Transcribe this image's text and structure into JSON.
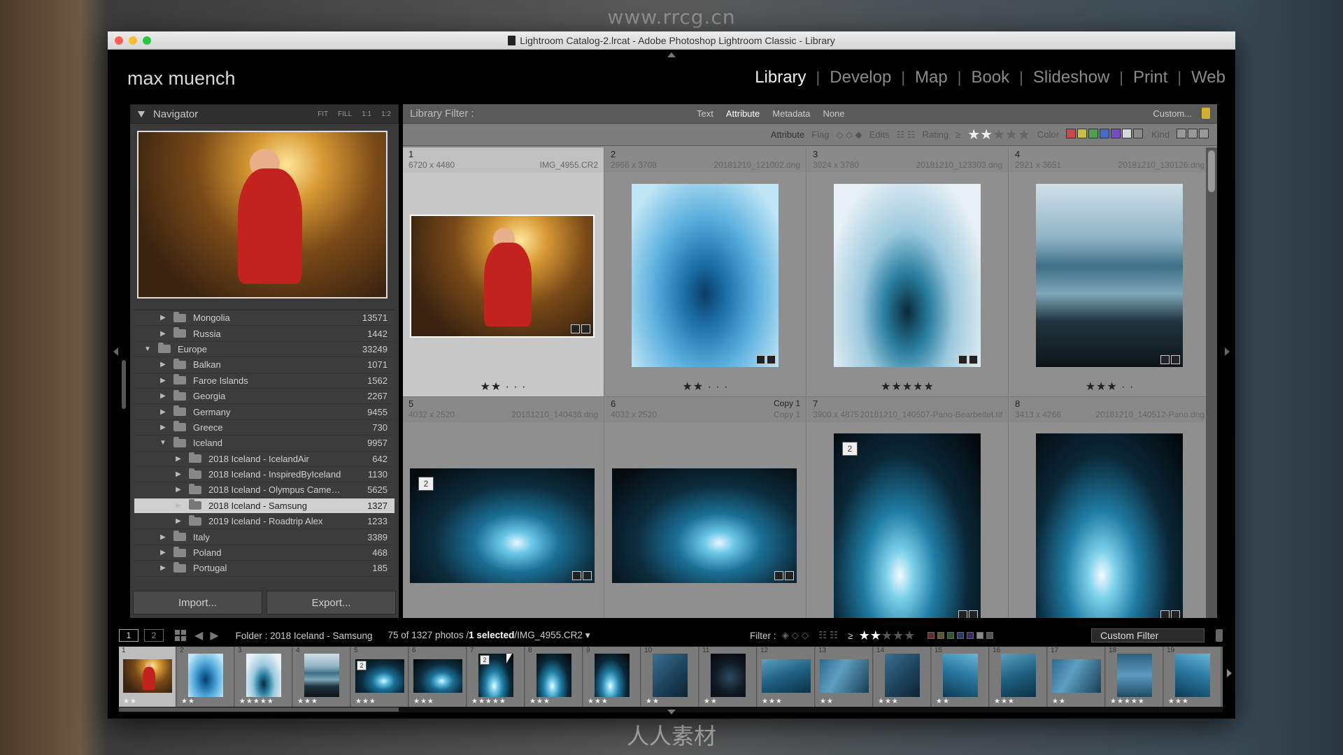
{
  "watermarks": {
    "top": "www.rrcg.cn",
    "bottom": "人人素材"
  },
  "window": {
    "title": "Lightroom Catalog-2.lrcat - Adobe Photoshop Lightroom Classic - Library"
  },
  "identity_plate": "max muench",
  "modules": [
    {
      "label": "Library",
      "active": true
    },
    {
      "label": "Develop"
    },
    {
      "label": "Map"
    },
    {
      "label": "Book"
    },
    {
      "label": "Slideshow"
    },
    {
      "label": "Print"
    },
    {
      "label": "Web"
    }
  ],
  "navigator": {
    "title": "Navigator",
    "zoom_options": [
      "FIT",
      "FILL",
      "1:1",
      "1:2"
    ]
  },
  "folders": [
    {
      "label": "Mongolia",
      "count": "13571",
      "level": 1,
      "expanded": false
    },
    {
      "label": "Russia",
      "count": "1442",
      "level": 1,
      "expanded": false
    },
    {
      "label": "Europe",
      "count": "33249",
      "level": 0,
      "expanded": true
    },
    {
      "label": "Balkan",
      "count": "1071",
      "level": 1,
      "expanded": false
    },
    {
      "label": "Faroe Islands",
      "count": "1562",
      "level": 1,
      "expanded": false
    },
    {
      "label": "Georgia",
      "count": "2267",
      "level": 1,
      "expanded": false
    },
    {
      "label": "Germany",
      "count": "9455",
      "level": 1,
      "expanded": false
    },
    {
      "label": "Greece",
      "count": "730",
      "level": 1,
      "expanded": false
    },
    {
      "label": "Iceland",
      "count": "9957",
      "level": 1,
      "expanded": true
    },
    {
      "label": "2018 Iceland - IcelandAir",
      "count": "642",
      "level": 2,
      "expanded": false
    },
    {
      "label": "2018 Iceland - InspiredByIceland",
      "count": "1130",
      "level": 2,
      "expanded": false
    },
    {
      "label": "2018 Iceland - Olympus Came…",
      "count": "5625",
      "level": 2,
      "expanded": false
    },
    {
      "label": "2018 Iceland - Samsung",
      "count": "1327",
      "level": 2,
      "expanded": false,
      "selected": true
    },
    {
      "label": "2019 Iceland - Roadtrip Alex",
      "count": "1233",
      "level": 2,
      "expanded": false
    },
    {
      "label": "Italy",
      "count": "3389",
      "level": 1,
      "expanded": false
    },
    {
      "label": "Poland",
      "count": "468",
      "level": 1,
      "expanded": false
    },
    {
      "label": "Portugal",
      "count": "185",
      "level": 1,
      "expanded": false
    }
  ],
  "buttons": {
    "import": "Import...",
    "export": "Export..."
  },
  "library_filter": {
    "title": "Library Filter :",
    "tabs": [
      {
        "label": "Text"
      },
      {
        "label": "Attribute",
        "active": true
      },
      {
        "label": "Metadata"
      },
      {
        "label": "None"
      }
    ],
    "preset": "Custom...",
    "attribute_bar": {
      "attribute_label": "Attribute",
      "flag_label": "Flag",
      "edits_label": "Edits",
      "rating_label": "Rating",
      "rating_op": "≥",
      "rating_value": 2,
      "color_label": "Color",
      "colors": [
        "#c84a4a",
        "#c8c040",
        "#50a050",
        "#4a6ac8",
        "#7a4ac0",
        "#d8d8d8",
        "#8a8a8a"
      ],
      "kind_label": "Kind"
    }
  },
  "grid": [
    {
      "index": "1",
      "dims": "6720 x 4480",
      "file": "IMG_4955.CR2",
      "rating": 2,
      "selected": true,
      "art": "art-room",
      "orient": "land"
    },
    {
      "index": "2",
      "dims": "2966 x 3708",
      "file": "20181210_121002.dng",
      "rating": 2,
      "art": "art-ice1",
      "orient": "port"
    },
    {
      "index": "3",
      "dims": "3024 x 3780",
      "file": "20181210_123303.dng",
      "rating": 5,
      "art": "art-ice2",
      "orient": "port"
    },
    {
      "index": "4",
      "dims": "2921 x 3651",
      "file": "20181210_130126.dng",
      "rating": 3,
      "art": "art-lake",
      "orient": "port"
    },
    {
      "index": "5",
      "dims": "4032 x 2520",
      "file": "20181210_140438.dng",
      "stack": "2",
      "art": "art-cave",
      "orient": "land"
    },
    {
      "index": "6",
      "dims": "4032 x 2520",
      "file": "Copy 1",
      "copy": "Copy 1",
      "art": "art-cave",
      "orient": "land"
    },
    {
      "index": "7",
      "dims": "3900 x 4875",
      "file": "20181210_140507-Pano-Bearbeitet.tif",
      "stack": "2",
      "art": "art-cave-v",
      "orient": "port"
    },
    {
      "index": "8",
      "dims": "3413 x 4266",
      "file": "20181210_140512-Pano.dng",
      "art": "art-cave-v",
      "orient": "port"
    }
  ],
  "filmbar": {
    "screen1": "1",
    "screen2": "2",
    "path": "Folder : 2018 Iceland - Samsung",
    "count_prefix": "75 of 1327 photos /",
    "count_selected": "1 selected",
    "count_file": "/IMG_4955.CR2",
    "filter_label": "Filter :",
    "rating_op": "≥",
    "rating_value": 2,
    "filter_preset": "Custom Filter"
  },
  "filmstrip": [
    {
      "n": "1",
      "stars": "★★",
      "art": "art-room",
      "selected": true
    },
    {
      "n": "2",
      "stars": "★★",
      "art": "art-ice1"
    },
    {
      "n": "3",
      "stars": "★★★★★",
      "art": "art-ice2"
    },
    {
      "n": "4",
      "stars": "★★★",
      "art": "art-lake"
    },
    {
      "n": "5",
      "stars": "★★★",
      "art": "art-cave",
      "stack": "2"
    },
    {
      "n": "6",
      "stars": "★★★",
      "art": "art-cave"
    },
    {
      "n": "7",
      "stars": "★★★★★",
      "art": "art-cave-v",
      "stack": "2"
    },
    {
      "n": "8",
      "stars": "★★★",
      "art": "art-cave-v"
    },
    {
      "n": "9",
      "stars": "★★★",
      "art": "art-cave-v"
    },
    {
      "n": "10",
      "stars": "★★",
      "art": "art-blue1"
    },
    {
      "n": "11",
      "stars": "★★",
      "art": "art-dark"
    },
    {
      "n": "12",
      "stars": "★★★",
      "art": "art-blue2"
    },
    {
      "n": "13",
      "stars": "★★",
      "art": "art-blue3"
    },
    {
      "n": "14",
      "stars": "★★★",
      "art": "art-blue1"
    },
    {
      "n": "15",
      "stars": "★★",
      "art": "art-blue4"
    },
    {
      "n": "16",
      "stars": "★★★",
      "art": "art-blue2"
    },
    {
      "n": "17",
      "stars": "★★",
      "art": "art-blue3"
    },
    {
      "n": "18",
      "stars": "★★★★★",
      "art": "art-red"
    },
    {
      "n": "19",
      "stars": "★★★",
      "art": "art-blue4"
    }
  ]
}
